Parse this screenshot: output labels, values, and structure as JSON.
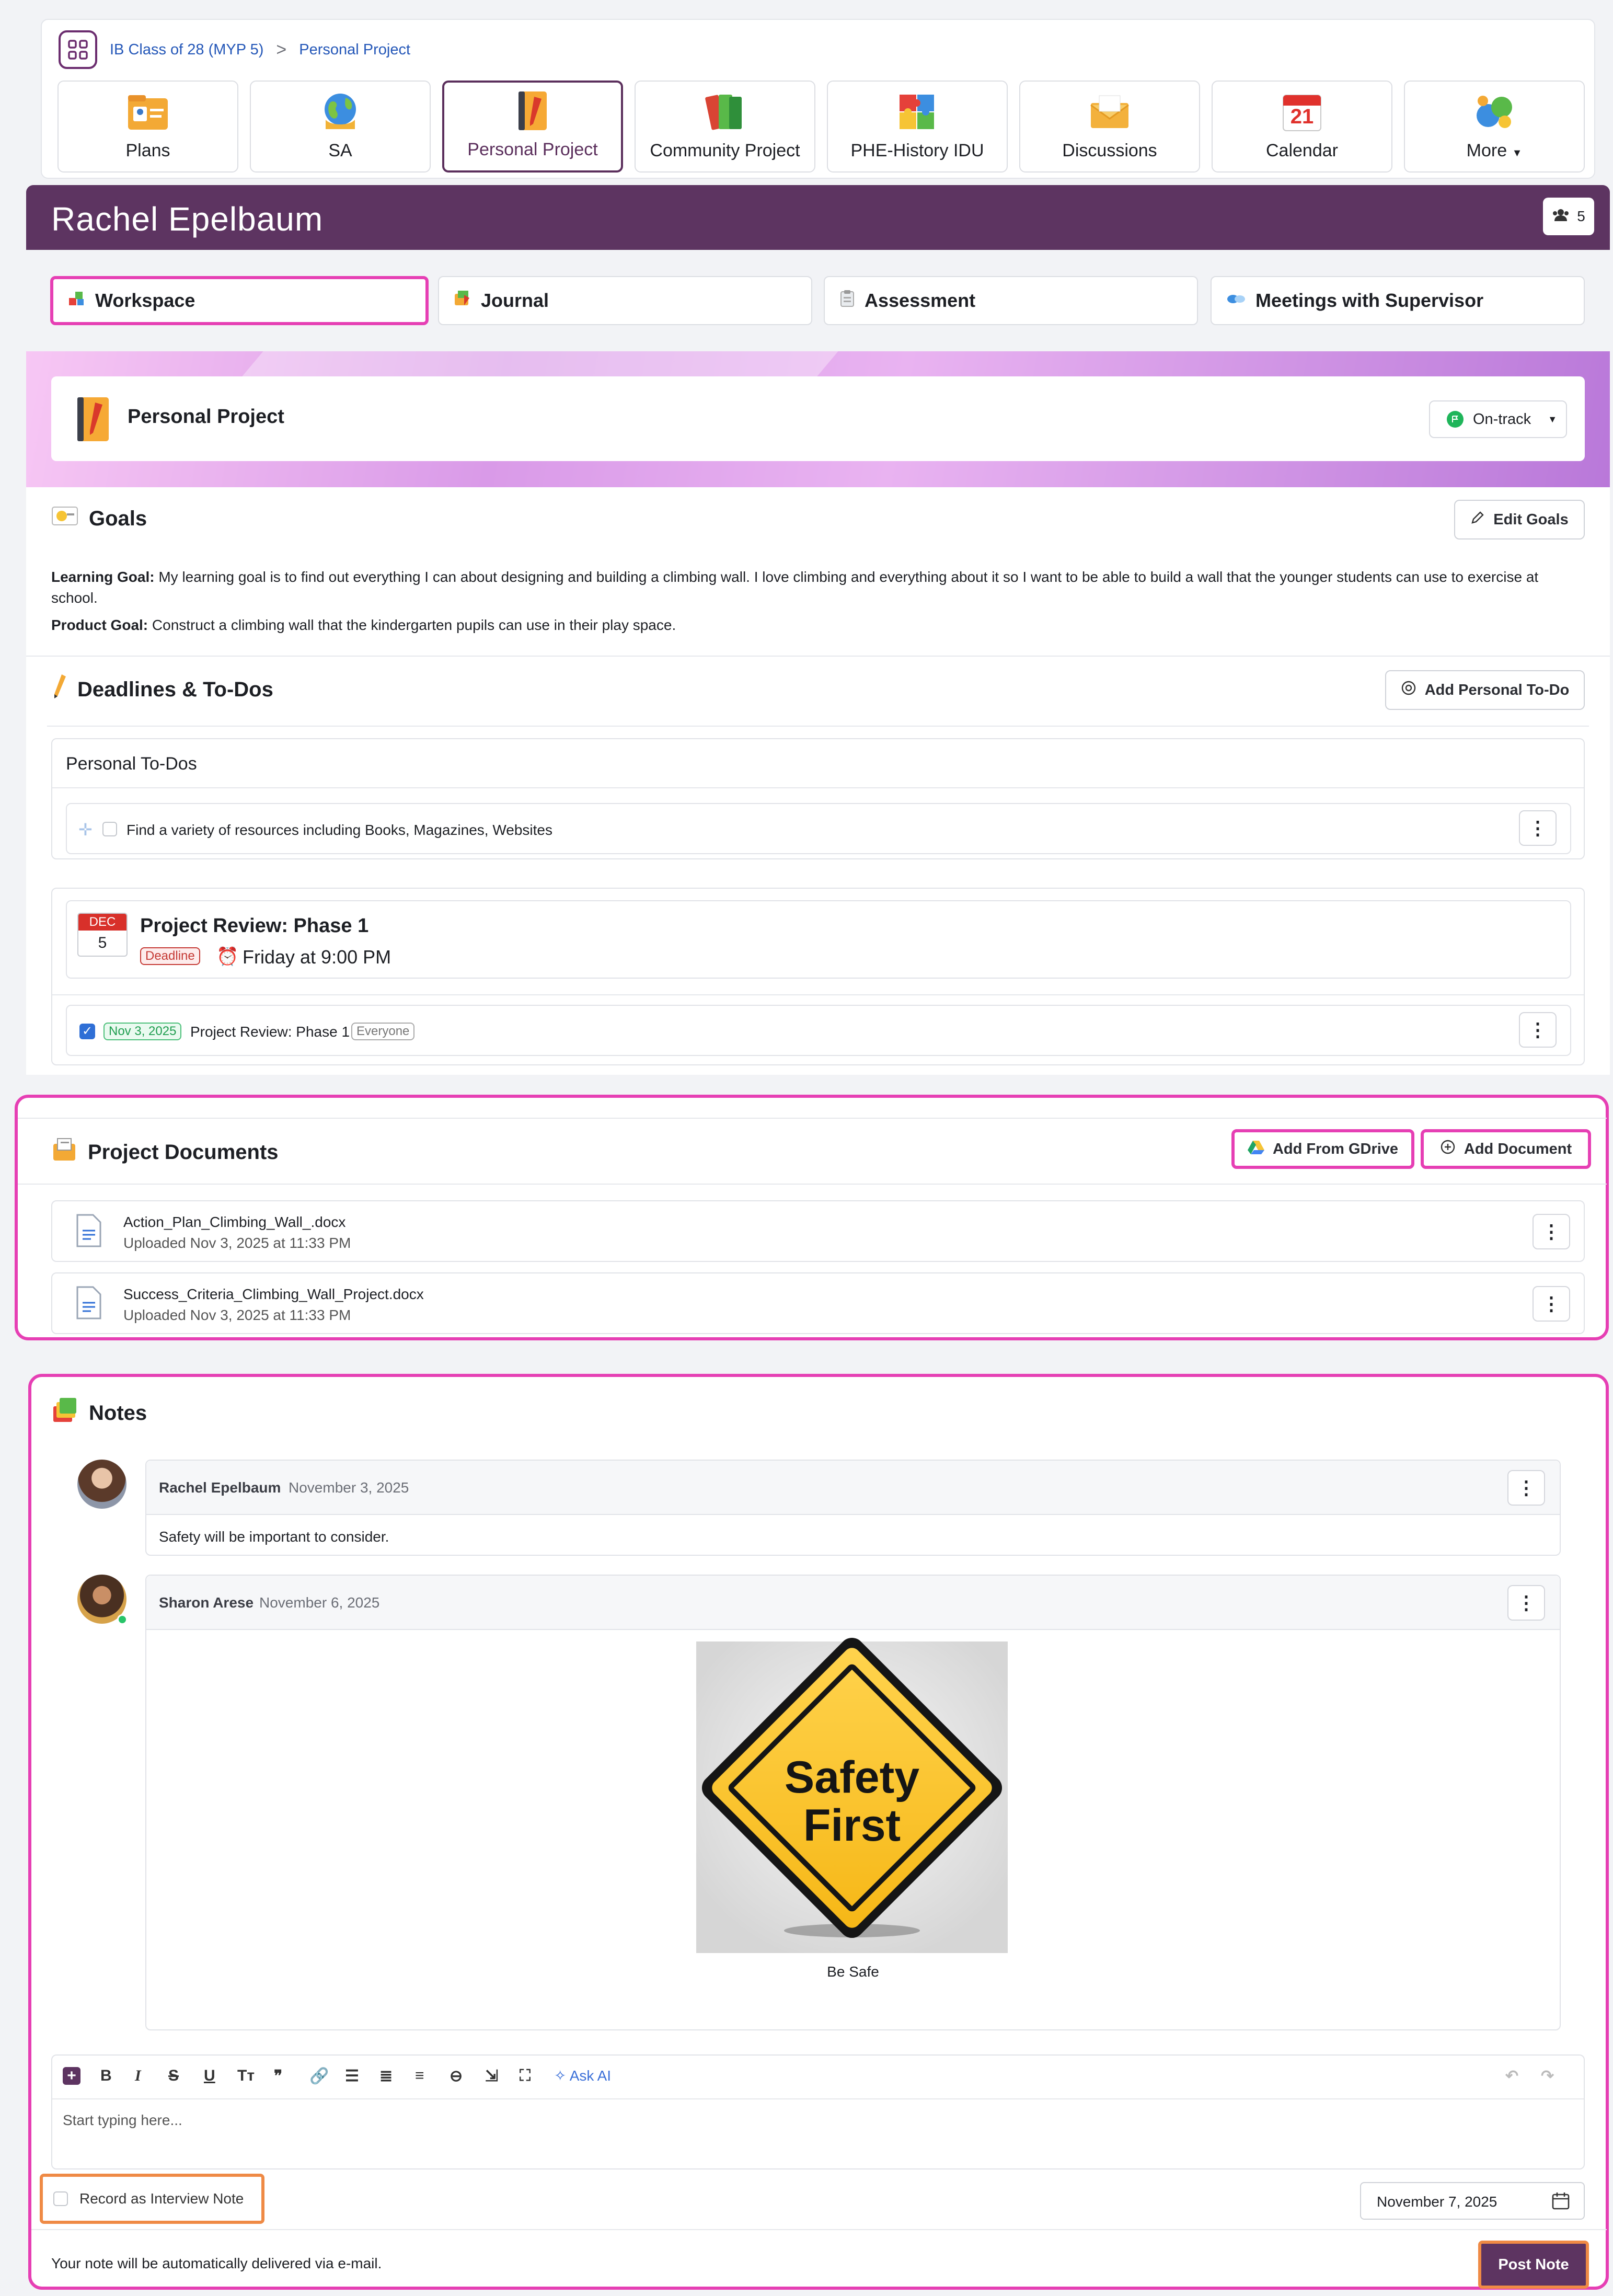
{
  "breadcrumb": {
    "class_name": "IB Class of 28 (MYP 5)",
    "separator": ">",
    "current": "Personal Project"
  },
  "nav_tabs": [
    {
      "label": "Plans",
      "icon": "plans-icon"
    },
    {
      "label": "SA",
      "icon": "globe-icon"
    },
    {
      "label": "Personal Project",
      "icon": "notebook-icon"
    },
    {
      "label": "Community Project",
      "icon": "books-icon"
    },
    {
      "label": "PHE-History IDU",
      "icon": "puzzle-icon"
    },
    {
      "label": "Discussions",
      "icon": "envelope-icon"
    },
    {
      "label": "Calendar",
      "icon": "calendar-icon",
      "day": "21"
    },
    {
      "label": "More",
      "icon": "more-icon"
    }
  ],
  "student": {
    "name": "Rachel Epelbaum",
    "member_count": "5"
  },
  "subtabs": [
    {
      "label": "Workspace"
    },
    {
      "label": "Journal"
    },
    {
      "label": "Assessment"
    },
    {
      "label": "Meetings with Supervisor"
    }
  ],
  "project": {
    "title": "Personal Project",
    "status": "On-track",
    "status_color": "#1fb55a"
  },
  "goals": {
    "title": "Goals",
    "edit_label": "Edit Goals",
    "learning_label": "Learning Goal:",
    "learning_text": "My learning goal is to find out everything I can about designing and building a climbing wall. I love climbing and everything about it so I want to be able to build a wall that the younger students can use to exercise at school.",
    "product_label": "Product Goal:",
    "product_text": "Construct a climbing wall that the kindergarten pupils can use in their play space."
  },
  "deadlines": {
    "title": "Deadlines & To-Dos",
    "add_label": "Add Personal To-Do",
    "personal_header": "Personal To-Dos",
    "todo_text": "Find a variety of resources including Books, Magazines, Websites",
    "event": {
      "month": "DEC",
      "day": "5",
      "title": "Project Review: Phase 1",
      "tag": "Deadline",
      "when": "Friday at 9:00 PM"
    },
    "task": {
      "date": "Nov 3, 2025",
      "title": "Project Review: Phase 1",
      "audience": "Everyone"
    }
  },
  "documents": {
    "title": "Project Documents",
    "gdrive_label": "Add From GDrive",
    "add_label": "Add Document",
    "files": [
      {
        "name": "Action_Plan_Climbing_Wall_.docx",
        "uploaded": "Uploaded Nov 3, 2025 at 11:33 PM"
      },
      {
        "name": "Success_Criteria_Climbing_Wall_Project.docx",
        "uploaded": "Uploaded Nov 3, 2025 at 11:33 PM"
      }
    ]
  },
  "notes": {
    "title": "Notes",
    "items": [
      {
        "author": "Rachel Epelbaum",
        "date": "November 3, 2025",
        "text": "Safety will be important to consider."
      },
      {
        "author": "Sharon Arese",
        "date": "November 6, 2025",
        "image_line1": "Safety",
        "image_line2": "First",
        "caption": "Be Safe"
      }
    ],
    "toolbar": {
      "ask_ai": "Ask AI"
    },
    "editor_placeholder": "Start typing here...",
    "interview_label": "Record as Interview Note",
    "date_value": "November 7, 2025",
    "email_notice": "Your note will be automatically delivered via e-mail.",
    "post_label": "Post Note"
  },
  "colors": {
    "brand": "#5d3461",
    "highlight_pink": "#e63fb4",
    "highlight_orange": "#ef8a45",
    "link": "#2457b8"
  }
}
